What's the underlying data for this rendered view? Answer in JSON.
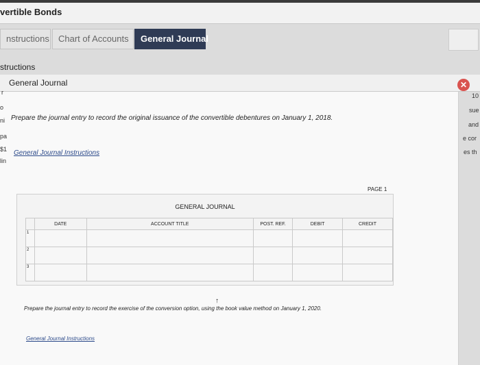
{
  "app": {
    "title": "vertible Bonds"
  },
  "tabs": [
    {
      "label": "nstructions"
    },
    {
      "label": "Chart of Accounts"
    },
    {
      "label": "General Journal"
    }
  ],
  "section": {
    "label": "structions"
  },
  "panel": {
    "title": "General Journal",
    "close_symbol": "✕",
    "question1": "Prepare the journal entry to record the original issuance of the convertible debentures on January 1, 2018.",
    "link1": "General Journal Instructions",
    "question2": "Prepare the journal entry to record the exercise of the conversion option, using the book value method on January 1, 2020.",
    "link2": "General Journal Instructions"
  },
  "journal": {
    "page_label": "PAGE 1",
    "title": "GENERAL JOURNAL",
    "headers": {
      "date": "DATE",
      "account": "ACCOUNT TITLE",
      "post": "POST. REF.",
      "debit": "DEBIT",
      "credit": "CREDIT"
    },
    "rows": [
      {
        "num": "1"
      },
      {
        "num": "2"
      },
      {
        "num": "3"
      }
    ]
  },
  "background_fragments": {
    "left": [
      "r",
      "o",
      "ni",
      "pa",
      "$1",
      "lin"
    ],
    "right": [
      "10",
      "sue",
      "and",
      "e cor",
      "es th"
    ]
  }
}
